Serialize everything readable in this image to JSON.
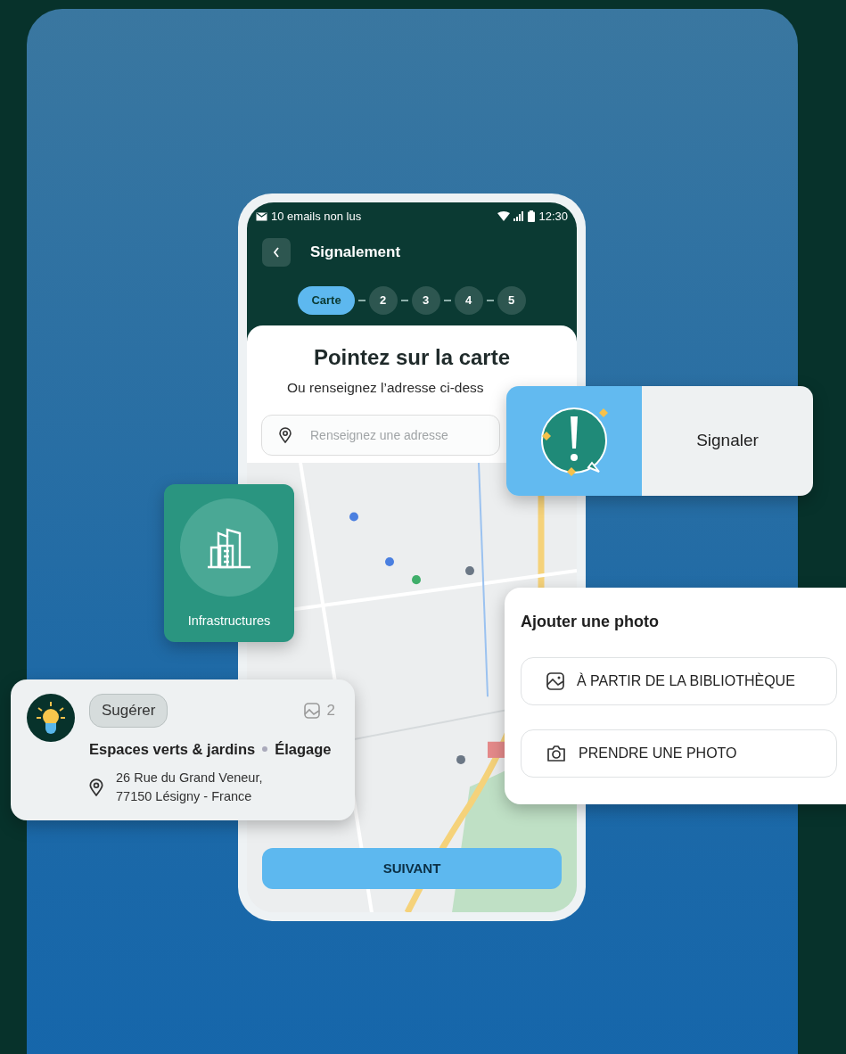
{
  "status_bar": {
    "notification": "10 emails non lus",
    "time": "12:30"
  },
  "header": {
    "title": "Signalement"
  },
  "steps": [
    {
      "label": "Carte",
      "selected": true
    },
    {
      "label": "2",
      "selected": false
    },
    {
      "label": "3",
      "selected": false
    },
    {
      "label": "4",
      "selected": false
    },
    {
      "label": "5",
      "selected": false
    }
  ],
  "sheet": {
    "title": "Pointez sur la carte",
    "subtitle": "Ou renseignez l’adresse ci-dess",
    "address_field": {
      "placeholder": "Renseignez une adresse"
    }
  },
  "next_button": "SUIVANT",
  "report_card": {
    "label": "Signaler"
  },
  "category_card": {
    "label": "Infrastructures"
  },
  "suggestion_card": {
    "tag": "Sugérer",
    "photo_count": "2",
    "category": "Espaces verts & jardins",
    "subcategory": "Élagage",
    "address_lines": [
      "26 Rue du Grand Veneur,",
      "77150 Lésigny - France"
    ]
  },
  "photo_card": {
    "title": "Ajouter une photo",
    "options": [
      {
        "kind": "library",
        "label": "À PARTIR DE LA BIBLIOTHÈQUE"
      },
      {
        "kind": "camera",
        "label": "PRENDRE UNE PHOTO"
      }
    ]
  }
}
